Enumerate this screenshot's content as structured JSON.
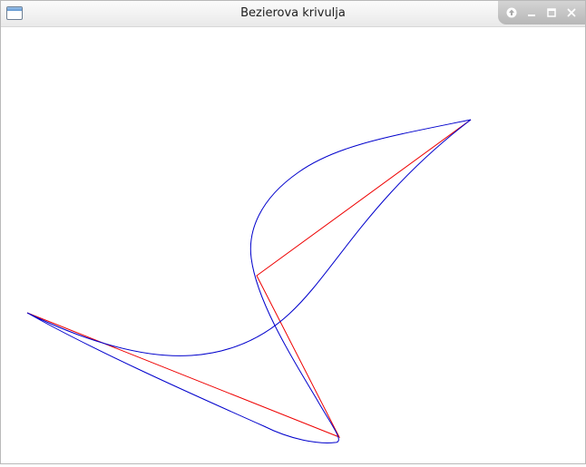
{
  "window": {
    "title": "Bezierova krivulja"
  },
  "titlebar_controls": [
    {
      "name": "shade-button",
      "icon": "arrow-up-icon"
    },
    {
      "name": "minimize-button",
      "icon": "minimize-icon"
    },
    {
      "name": "maximize-button",
      "icon": "maximize-icon"
    },
    {
      "name": "close-button",
      "icon": "close-icon"
    }
  ],
  "colors": {
    "curve": "#0000cc",
    "control_polygon": "#ee0000"
  }
}
